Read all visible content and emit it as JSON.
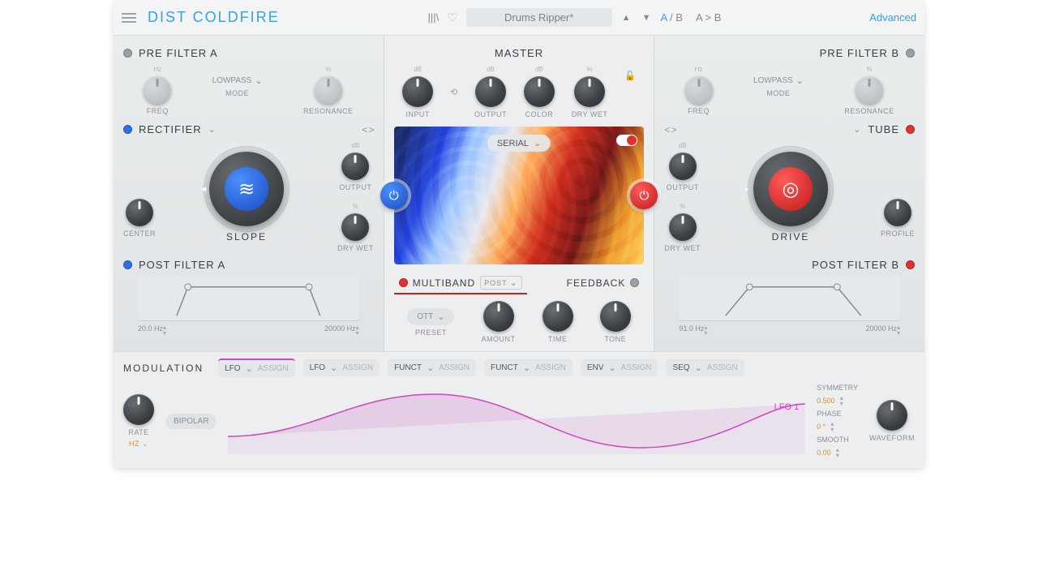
{
  "header": {
    "title": "DIST COLDFIRE",
    "preset": "Drums Ripper*",
    "ab_active": "A",
    "ab_inactive": "B",
    "ab_copy": "A > B",
    "advanced": "Advanced"
  },
  "prefilter_a": {
    "title": "PRE FILTER A",
    "freq": "FREQ",
    "mode_label": "MODE",
    "mode_value": "LOWPASS",
    "res": "RESONANCE"
  },
  "prefilter_b": {
    "title": "PRE FILTER B",
    "freq": "FREQ",
    "mode_label": "MODE",
    "mode_value": "LOWPASS",
    "res": "RESONANCE"
  },
  "master": {
    "title": "MASTER",
    "input": "INPUT",
    "output": "OUTPUT",
    "color": "COLOR",
    "drywet": "DRY  WET"
  },
  "dist_a": {
    "title": "RECTIFIER",
    "big": "SLOPE",
    "center": "CENTER",
    "output": "OUTPUT",
    "drywet": "DRY WET"
  },
  "dist_b": {
    "title": "TUBE",
    "big": "DRIVE",
    "output": "OUTPUT",
    "drywet": "DRY WET",
    "profile": "PROFILE"
  },
  "routing": "SERIAL",
  "postfilter_a": {
    "title": "POST FILTER A",
    "lo": "20.0 Hz",
    "hi": "20000 Hz"
  },
  "postfilter_b": {
    "title": "POST FILTER B",
    "lo": "91.0 Hz",
    "hi": "20000 Hz"
  },
  "multiband": {
    "title": "MULTIBAND",
    "post": "POST",
    "preset_label": "PRESET",
    "preset_value": "OTT",
    "amount": "AMOUNT",
    "time": "TIME",
    "tone": "TONE",
    "feedback": "FEEDBACK"
  },
  "modulation": {
    "title": "MODULATION",
    "slots": [
      {
        "type": "LFO",
        "assign": "ASSIGN"
      },
      {
        "type": "LFO",
        "assign": "ASSIGN"
      },
      {
        "type": "FUNCT",
        "assign": "ASSIGN"
      },
      {
        "type": "FUNCT",
        "assign": "ASSIGN"
      },
      {
        "type": "ENV",
        "assign": "ASSIGN"
      },
      {
        "type": "SEQ",
        "assign": "ASSIGN"
      }
    ],
    "rate": "RATE",
    "rate_unit": "HZ",
    "bipolar": "BIPOLAR",
    "lfo_name": "LFO 1",
    "symmetry_label": "SYMMETRY",
    "symmetry_value": "0.500",
    "phase_label": "PHASE",
    "phase_value": "0 °",
    "smooth_label": "SMOOTH",
    "smooth_value": "0.00",
    "waveform": "WAVEFORM"
  },
  "db": "dB",
  "pct": "%",
  "hz": "Hz"
}
